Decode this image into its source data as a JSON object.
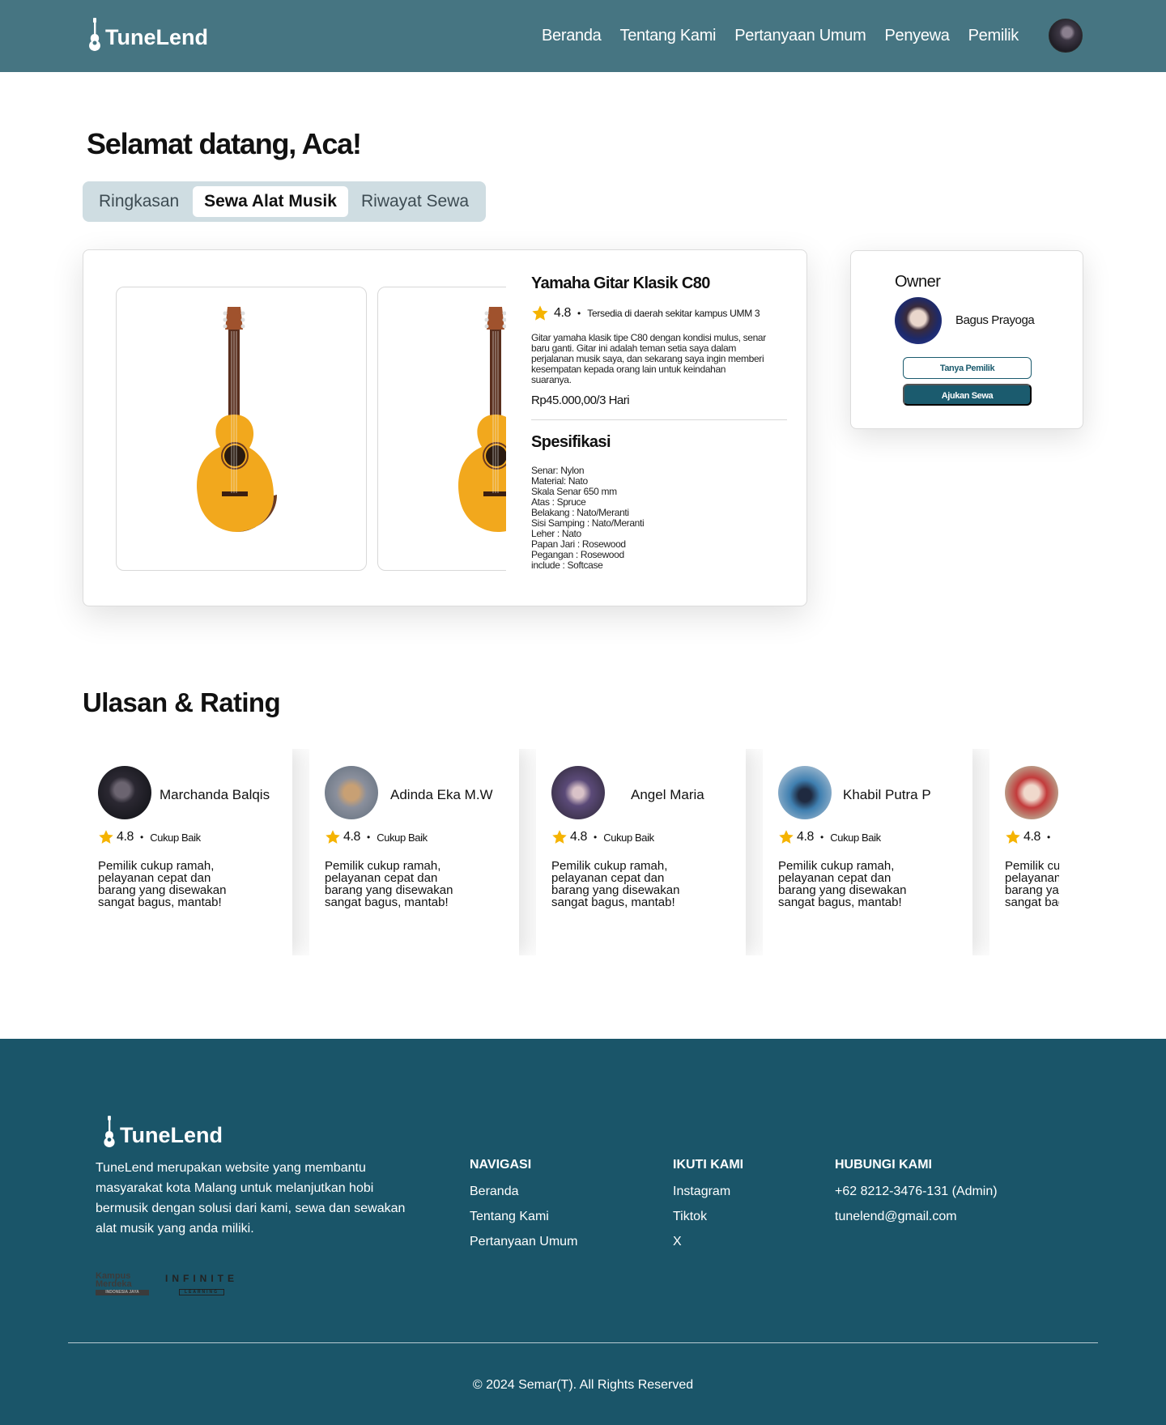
{
  "header": {
    "brand": "TuneLend",
    "nav": [
      "Beranda",
      "Tentang Kami",
      "Pertanyaan Umum",
      "Penyewa",
      "Pemilik"
    ]
  },
  "greeting": {
    "prefix": "Selamat datang, ",
    "name": "Aca!"
  },
  "tabs": [
    "Ringkasan",
    "Sewa Alat Musik",
    "Riwayat Sewa"
  ],
  "product": {
    "title": "Yamaha Gitar Klasik C80",
    "rating": "4.8",
    "location": "Tersedia di daerah sekitar kampus UMM 3",
    "description": "Gitar yamaha klasik tipe C80 dengan kondisi mulus, senar baru ganti. Gitar ini adalah teman setia saya dalam perjalanan musik saya, dan sekarang saya ingin memberi kesempatan kepada orang lain untuk keindahan suaranya.",
    "price": "Rp45.000,00/3 Hari",
    "spec_title": "Spesifikasi",
    "specs": [
      "Senar: Nylon",
      "Material: Nato",
      "Skala Senar 650 mm",
      "Atas : Spruce",
      "Belakang : Nato/Meranti",
      "Sisi Samping : Nato/Meranti",
      "Leher : Nato",
      "Papan Jari : Rosewood",
      "Pegangan : Rosewood",
      "include : Softcase"
    ]
  },
  "owner": {
    "label": "Owner",
    "name": "Bagus Prayoga",
    "ask_button": "Tanya Pemilik",
    "rent_button": "Ajukan Sewa"
  },
  "reviews": {
    "title": "Ulasan & Rating",
    "items": [
      {
        "name": "Marchanda Balqis",
        "rating": "4.8",
        "label": "Cukup Baik",
        "text": "Pemilik cukup ramah, pelayanan cepat dan barang yang disewakan sangat bagus, mantab!"
      },
      {
        "name": "Adinda Eka M.W",
        "rating": "4.8",
        "label": "Cukup Baik",
        "text": "Pemilik cukup ramah, pelayanan cepat dan barang yang disewakan sangat bagus, mantab!"
      },
      {
        "name": "Angel Maria",
        "rating": "4.8",
        "label": "Cukup Baik",
        "text": "Pemilik cukup ramah, pelayanan cepat dan barang yang disewakan sangat bagus, mantab!"
      },
      {
        "name": "Khabil Putra P",
        "rating": "4.8",
        "label": "Cukup Baik",
        "text": "Pemilik cukup ramah, pelayanan cepat dan barang yang disewakan sangat bagus, mantab!"
      },
      {
        "name": "",
        "rating": "4.8",
        "label": "",
        "text": "Pemilik cukup ramah, pelayanan cepat dan barang yang disewakan sangat bagus, mantab!"
      }
    ]
  },
  "footer": {
    "brand": "TuneLend",
    "about": "TuneLend merupakan website yang membantu masyarakat kota Malang untuk melanjutkan hobi bermusik dengan solusi dari kami, sewa dan sewakan alat musik yang anda miliki.",
    "logos": {
      "kampus_merdeka": "Kampus Merdeka",
      "kampus_merdeka_sub": "INDONESIA JAYA",
      "infinite": "INFINITE",
      "infinite_sub": "LEARNING"
    },
    "nav_title": "NAVIGASI",
    "nav_links": [
      "Beranda",
      "Tentang Kami",
      "Pertanyaan Umum"
    ],
    "follow_title": "IKUTI KAMI",
    "follow_links": [
      "Instagram",
      "Tiktok",
      "X"
    ],
    "contact_title": "HUBUNGI KAMI",
    "contact_links": [
      "+62 8212-3476-131 (Admin)",
      "tunelend@gmail.com"
    ],
    "copyright": "© 2024 Semar(T). All Rights Reserved"
  },
  "colors": {
    "header_bg": "#467582",
    "footer_bg": "#1a5569",
    "primary_button": "#1b5b6e",
    "tab_bg": "#cfdde2",
    "star": "#f5b301"
  }
}
